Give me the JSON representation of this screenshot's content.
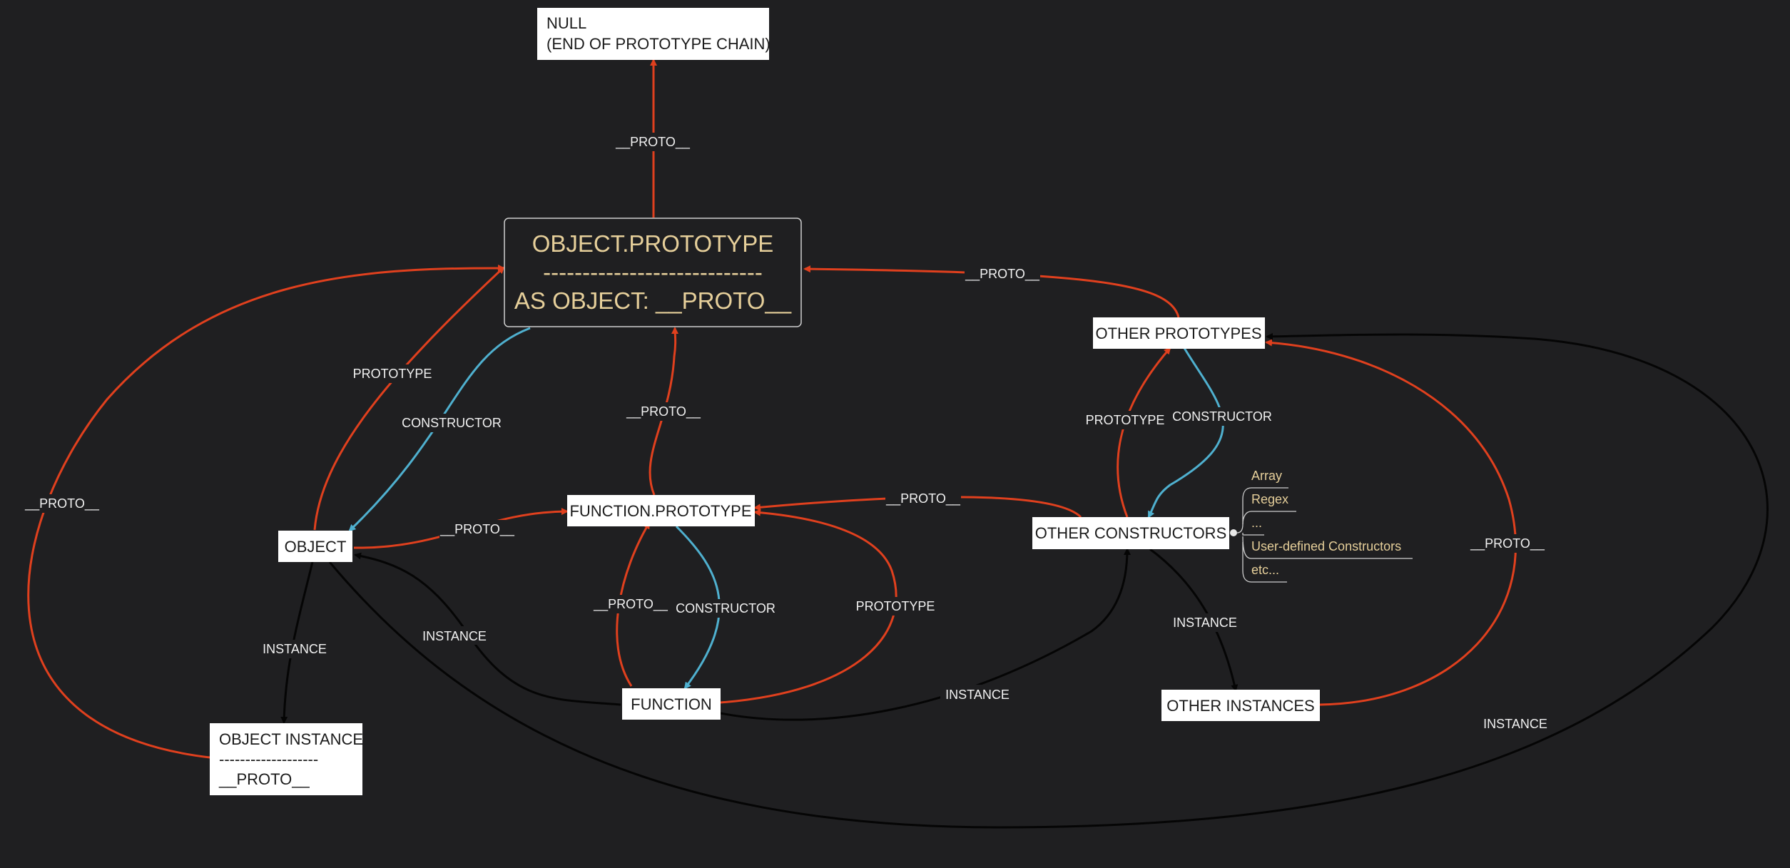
{
  "nodes": {
    "null_node": {
      "line1": "NULL",
      "line2": "(END OF PROTOTYPE CHAIN)"
    },
    "object_prototype": {
      "title": "OBJECT.PROTOTYPE",
      "divider": "----------------------------",
      "subtitle": "AS OBJECT:  __PROTO__"
    },
    "object": {
      "label": "OBJECT"
    },
    "function_prototype": {
      "label": "FUNCTION.PROTOTYPE"
    },
    "function": {
      "label": "FUNCTION"
    },
    "object_instance": {
      "line1": "OBJECT INSTANCE",
      "line2": "-------------------",
      "line3": "__PROTO__"
    },
    "other_prototypes": {
      "label": "OTHER PROTOTYPES"
    },
    "other_constructors": {
      "label": "OTHER CONSTRUCTORS"
    },
    "other_instances": {
      "label": "OTHER INSTANCES"
    }
  },
  "constructor_examples": [
    "Array",
    "Regex",
    "...",
    "User-defined Constructors",
    "etc..."
  ],
  "edge_labels": {
    "objproto_to_null": "__PROTO__",
    "otherproto_to_objproto": "__PROTO__",
    "object_prototype": "PROTOTYPE",
    "objproto_constructor": "CONSTRUCTOR",
    "instance_proto_outer": "__PROTO__",
    "funcproto_to_objproto": "__PROTO__",
    "object_to_funcproto": "__PROTO__",
    "otherctor_to_funcproto": "__PROTO__",
    "object_to_instance": "INSTANCE",
    "function_to_object_instance": "INSTANCE",
    "function_proto": "__PROTO__",
    "funcproto_constructor": "CONSTRUCTOR",
    "function_prototype": "PROTOTYPE",
    "function_to_otherctor": "INSTANCE",
    "otherctor_prototype": "PROTOTYPE",
    "otherproto_constructor": "CONSTRUCTOR",
    "otherctor_to_instances": "INSTANCE",
    "otherinstances_proto": "__PROTO__",
    "object_to_otherproto_instance": "INSTANCE"
  },
  "colors": {
    "background": "#1f1f21",
    "proto_edge": "#e0401e",
    "constructor_edge": "#4fb0cf",
    "instance_edge": "#050505",
    "highlight_text": "#e6cf9a"
  }
}
